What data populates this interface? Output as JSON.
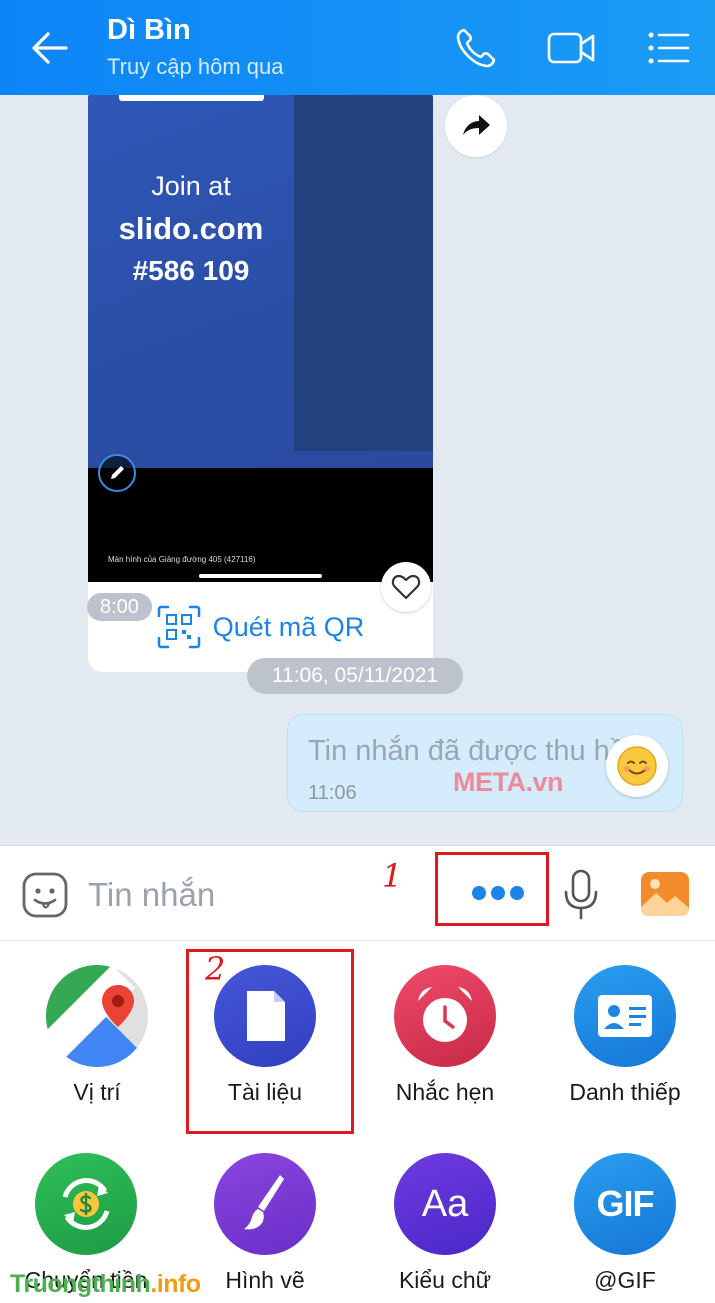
{
  "header": {
    "title": "Dì Bìn",
    "subtitle": "Truy cập hôm qua",
    "colors": {
      "background": "#1a92f6"
    }
  },
  "chat": {
    "image_message": {
      "slide_line1": "Join at",
      "slide_line2": "slido.com",
      "slide_line3": "#586 109",
      "screen_caption": "Màn hình của Giảng đường 405 (427116)",
      "action_label": "Quét mã QR",
      "time": "8:00"
    },
    "date_separator": "11:06, 05/11/2021",
    "recalled_message": {
      "text": "Tin nhắn đã được thu hồi",
      "time": "11:06"
    },
    "watermark": "META.vn"
  },
  "input": {
    "placeholder": "Tin nhắn",
    "annotation_1": "1",
    "annotation_2": "2"
  },
  "grid": {
    "items": [
      {
        "label": "Vị trí",
        "icon": "map-pin-icon"
      },
      {
        "label": "Tài liệu",
        "icon": "document-icon"
      },
      {
        "label": "Nhắc hẹn",
        "icon": "alarm-clock-icon"
      },
      {
        "label": "Danh thiếp",
        "icon": "contact-card-icon"
      },
      {
        "label": "Chuyển tiền",
        "icon": "money-transfer-icon"
      },
      {
        "label": "Hình vẽ",
        "icon": "brush-icon"
      },
      {
        "label": "Kiểu chữ",
        "icon": "font-style-icon"
      },
      {
        "label": "@GIF",
        "icon": "gif-icon"
      }
    ],
    "font_icon_text": "Aa",
    "gif_icon_text": "GIF"
  },
  "site_watermark": {
    "part1": "Truongthinh",
    "part2": ".info"
  },
  "accent_colors": {
    "blue": "#1a84e8",
    "red_annotation": "#e0191e"
  }
}
